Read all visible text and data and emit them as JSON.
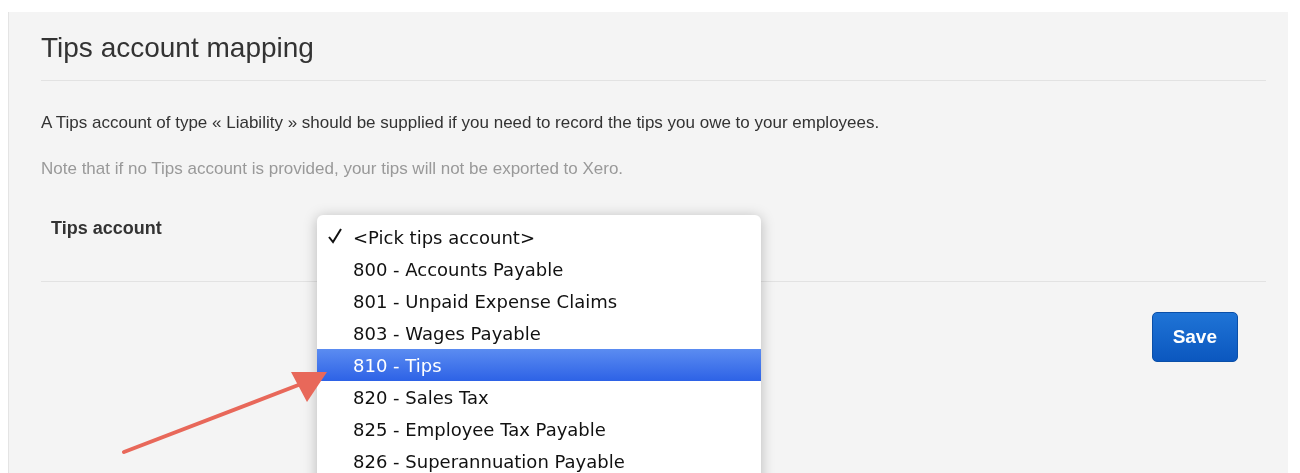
{
  "section": {
    "title": "Tips account mapping",
    "description": "A Tips account of type « Liability » should be supplied if you need to record the tips you owe to your employees.",
    "note": "Note that if no Tips account is provided, your tips will not be exported to Xero."
  },
  "form": {
    "label": "Tips account",
    "options": [
      {
        "label": "<Pick tips account>",
        "checked": true,
        "selected": false
      },
      {
        "label": "800 - Accounts Payable",
        "checked": false,
        "selected": false
      },
      {
        "label": "801 - Unpaid Expense Claims",
        "checked": false,
        "selected": false
      },
      {
        "label": "803 - Wages Payable",
        "checked": false,
        "selected": false
      },
      {
        "label": "810 - Tips",
        "checked": false,
        "selected": true
      },
      {
        "label": "820 - Sales Tax",
        "checked": false,
        "selected": false
      },
      {
        "label": "825 - Employee Tax Payable",
        "checked": false,
        "selected": false
      },
      {
        "label": "826 - Superannuation Payable",
        "checked": false,
        "selected": false
      }
    ]
  },
  "buttons": [
    {
      "label": "Save",
      "kind": "primary"
    }
  ]
}
